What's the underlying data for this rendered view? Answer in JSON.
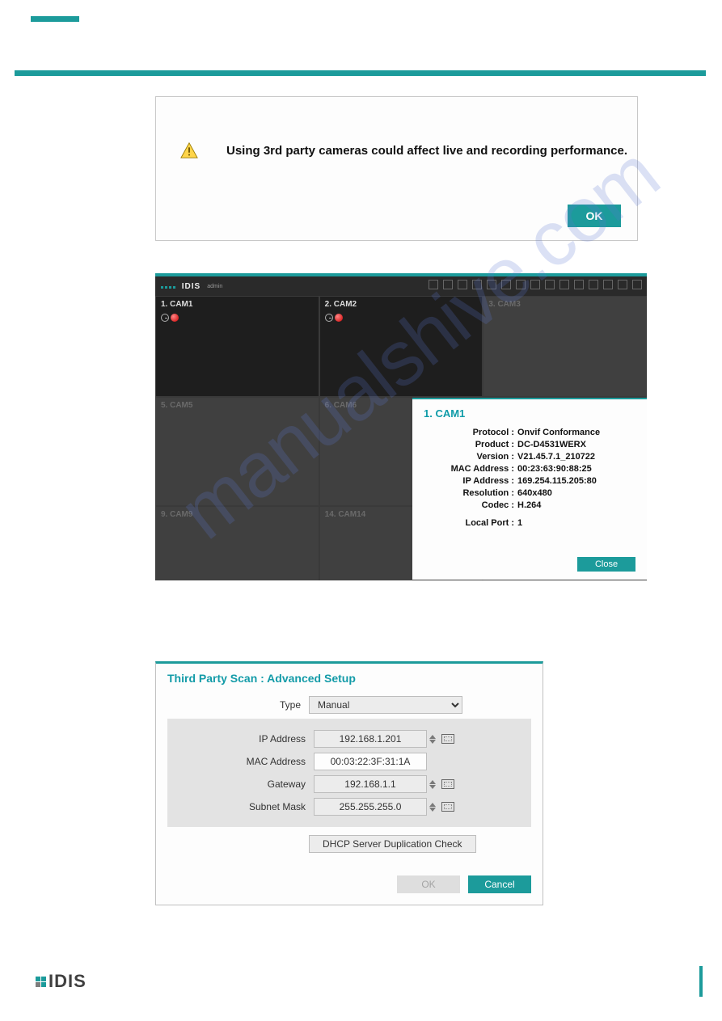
{
  "warning_dialog": {
    "message": "Using 3rd party cameras could affect live and recording performance.",
    "ok": "OK"
  },
  "nvr": {
    "brand": "IDIS",
    "user": "admin",
    "cams": [
      "1. CAM1",
      "2. CAM2",
      "3. CAM3",
      "5. CAM5",
      "6. CAM6",
      "9. CAM9",
      "14. CAM14"
    ]
  },
  "camera_popup": {
    "title": "1. CAM1",
    "fields": {
      "protocol_k": "Protocol :",
      "protocol_v": "Onvif Conformance",
      "product_k": "Product :",
      "product_v": "DC-D4531WERX",
      "version_k": "Version :",
      "version_v": "V21.45.7.1_210722",
      "mac_k": "MAC Address :",
      "mac_v": "00:23:63:90:88:25",
      "ip_k": "IP Address :",
      "ip_v": "169.254.115.205:80",
      "res_k": "Resolution :",
      "res_v": "640x480",
      "codec_k": "Codec :",
      "codec_v": "H.264",
      "localport_k": "Local Port :",
      "localport_v": "1"
    },
    "close": "Close"
  },
  "advanced_setup": {
    "title": "Third Party Scan : Advanced Setup",
    "labels": {
      "type": "Type",
      "ip": "IP Address",
      "mac": "MAC Address",
      "gateway": "Gateway",
      "subnet": "Subnet Mask"
    },
    "values": {
      "type": "Manual",
      "ip": "192.168.1.201",
      "mac": "00:03:22:3F:31:1A",
      "gateway": "192.168.1.1",
      "subnet": "255.255.255.0"
    },
    "dhcp_check": "DHCP Server Duplication Check",
    "ok": "OK",
    "cancel": "Cancel"
  },
  "footer": {
    "brand": "IDIS"
  },
  "watermark": "manualshive.com"
}
